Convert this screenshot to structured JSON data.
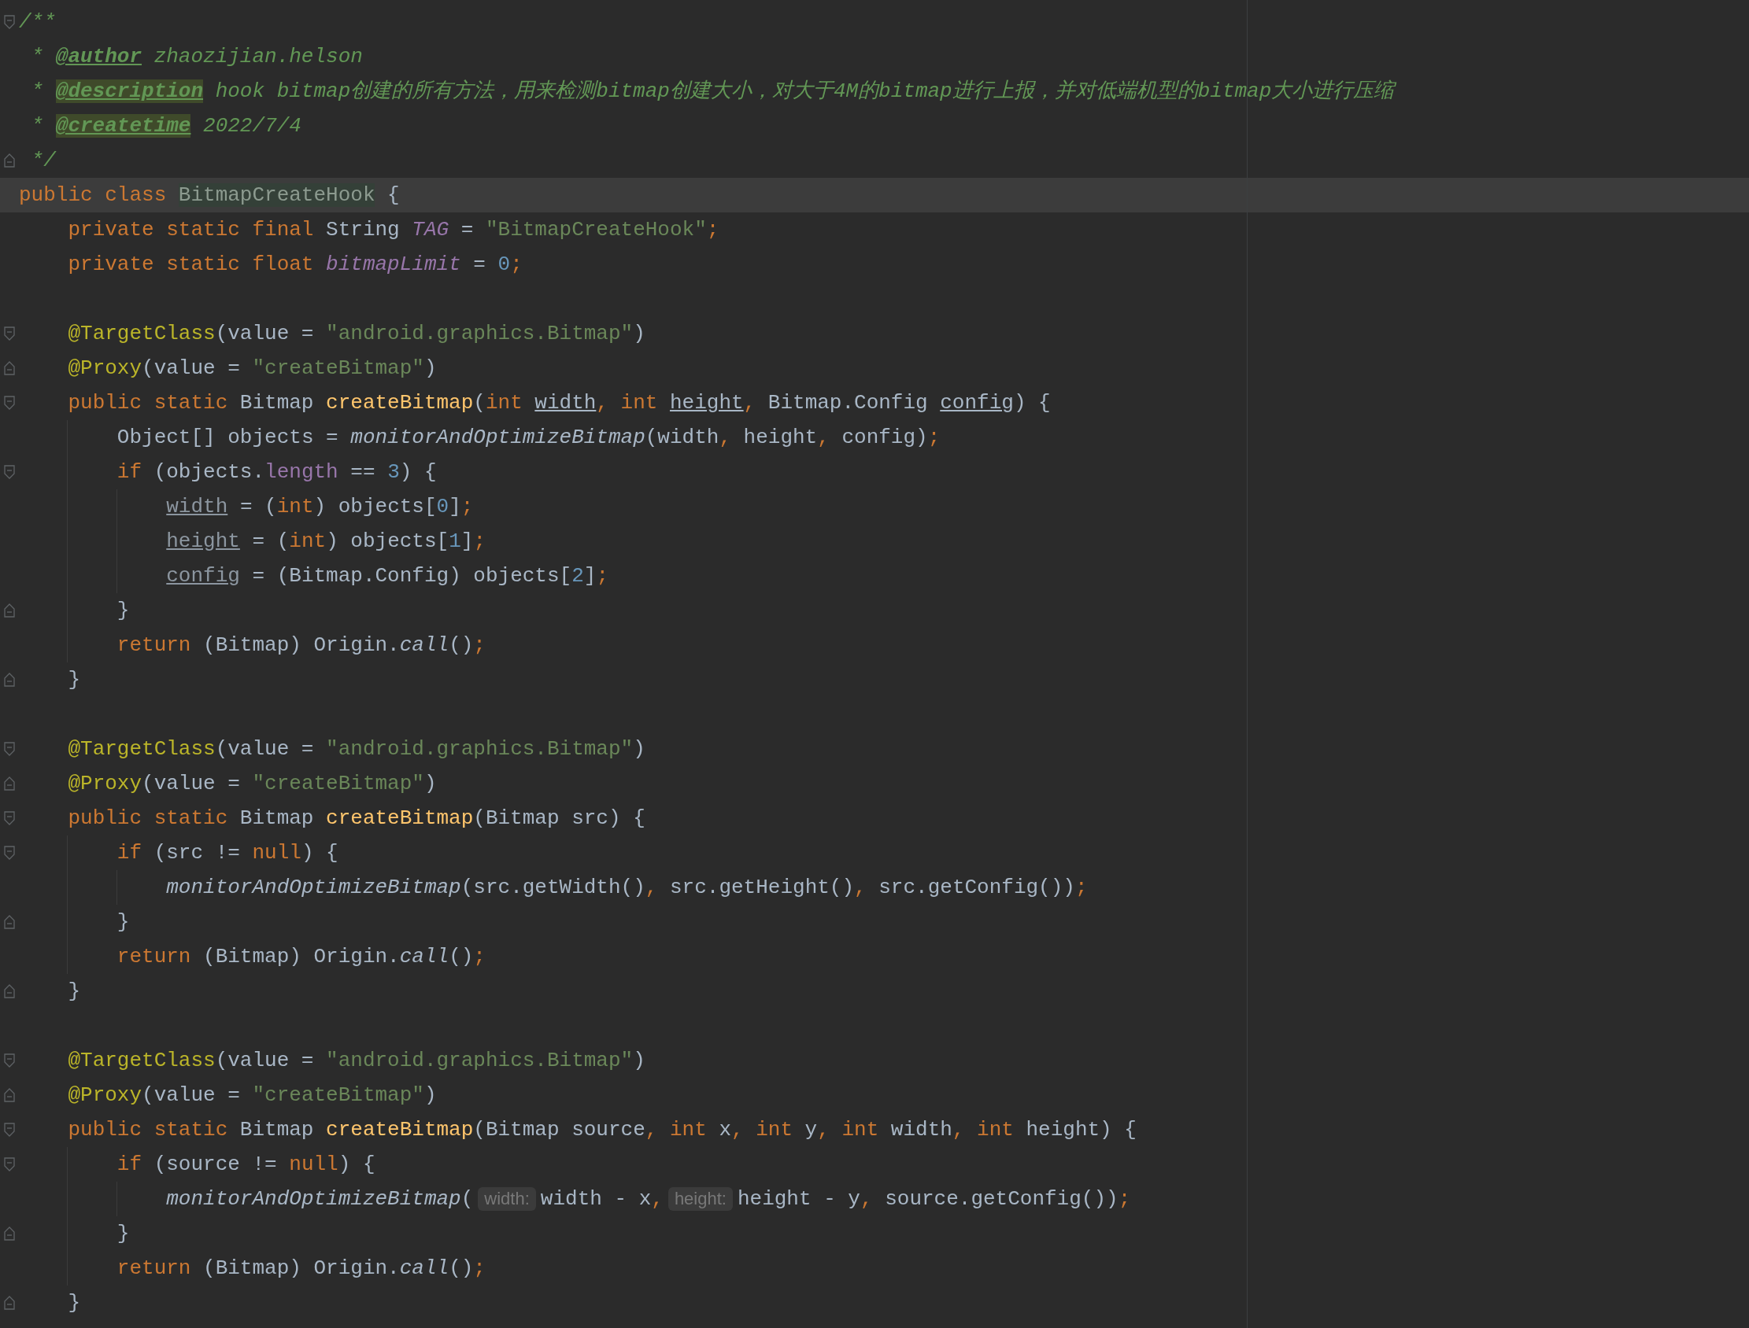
{
  "editor": {
    "lines": [
      {
        "current": false,
        "fold_start": true,
        "fold_end": false,
        "tokens": [
          {
            "kind": "doc",
            "text": "/**"
          }
        ]
      },
      {
        "current": false,
        "fold_start": false,
        "fold_end": false,
        "tokens": [
          {
            "kind": "doc",
            "text": " * "
          },
          {
            "kind": "doctag",
            "text": "@author"
          },
          {
            "kind": "doc",
            "text": " zhaozijian.helson"
          }
        ]
      },
      {
        "current": false,
        "fold_start": false,
        "fold_end": false,
        "tokens": [
          {
            "kind": "doc",
            "text": " * "
          },
          {
            "kind": "doctag_hl",
            "text": "@description"
          },
          {
            "kind": "doc",
            "text": " hook bitmap创建的所有方法，用来检测bitmap创建大小，对大于4M的bitmap进行上报，并对低端机型的bitmap大小进行压缩"
          }
        ]
      },
      {
        "current": false,
        "fold_start": false,
        "fold_end": false,
        "tokens": [
          {
            "kind": "doc",
            "text": " * "
          },
          {
            "kind": "doctag_hl",
            "text": "@createtime"
          },
          {
            "kind": "doc",
            "text": " 2022/7/4"
          }
        ]
      },
      {
        "current": false,
        "fold_start": false,
        "fold_end": true,
        "tokens": [
          {
            "kind": "doc",
            "text": " */"
          }
        ]
      },
      {
        "current": true,
        "fold_start": false,
        "fold_end": false,
        "tokens": [
          {
            "kind": "kw",
            "text": "public class "
          },
          {
            "kind": "classhl",
            "text": "BitmapCreateHook"
          },
          {
            "kind": "p",
            "text": " {"
          }
        ],
        "children": [
          {
            "current": false,
            "fold_start": false,
            "fold_end": false,
            "tokens": [
              {
                "kind": "kw",
                "text": "private static final "
              },
              {
                "kind": "p",
                "text": "String "
              },
              {
                "kind": "field",
                "text": "TAG"
              },
              {
                "kind": "p",
                "text": " = "
              },
              {
                "kind": "str",
                "text": "\"BitmapCreateHook\""
              },
              {
                "kind": "kw",
                "text": ";"
              }
            ]
          },
          {
            "current": false,
            "fold_start": false,
            "fold_end": false,
            "tokens": [
              {
                "kind": "kw",
                "text": "private static float "
              },
              {
                "kind": "field",
                "text": "bitmapLimit"
              },
              {
                "kind": "p",
                "text": " = "
              },
              {
                "kind": "num",
                "text": "0"
              },
              {
                "kind": "kw",
                "text": ";"
              }
            ]
          },
          {
            "current": false,
            "fold_start": false,
            "fold_end": false
          },
          {
            "current": false,
            "fold_start": true,
            "fold_end": false,
            "tokens": [
              {
                "kind": "ann",
                "text": "@TargetClass"
              },
              {
                "kind": "p",
                "text": "(value = "
              },
              {
                "kind": "str",
                "text": "\"android.graphics.Bitmap\""
              },
              {
                "kind": "p",
                "text": ")"
              }
            ]
          },
          {
            "current": false,
            "fold_start": false,
            "fold_end": true,
            "tokens": [
              {
                "kind": "ann",
                "text": "@Proxy"
              },
              {
                "kind": "p",
                "text": "(value = "
              },
              {
                "kind": "str",
                "text": "\"createBitmap\""
              },
              {
                "kind": "p",
                "text": ")"
              }
            ]
          },
          {
            "current": false,
            "fold_start": true,
            "fold_end": false,
            "tokens": [
              {
                "kind": "kw",
                "text": "public static "
              },
              {
                "kind": "p",
                "text": "Bitmap "
              },
              {
                "kind": "fndecl",
                "text": "createBitmap"
              },
              {
                "kind": "p",
                "text": "("
              },
              {
                "kind": "kw",
                "text": "int "
              },
              {
                "kind": "ul",
                "text": "width"
              },
              {
                "kind": "kw",
                "text": ", int "
              },
              {
                "kind": "ul",
                "text": "height"
              },
              {
                "kind": "kw",
                "text": ", "
              },
              {
                "kind": "p",
                "text": "Bitmap.Config "
              },
              {
                "kind": "ul",
                "text": "config"
              },
              {
                "kind": "p",
                "text": ") {"
              }
            ],
            "children": [
              {
                "current": false,
                "fold_start": false,
                "fold_end": false,
                "tokens": [
                  {
                    "kind": "p",
                    "text": "Object[] objects = "
                  },
                  {
                    "kind": "ital",
                    "text": "monitorAndOptimizeBitmap"
                  },
                  {
                    "kind": "p",
                    "text": "(width"
                  },
                  {
                    "kind": "kw",
                    "text": ", "
                  },
                  {
                    "kind": "p",
                    "text": "height"
                  },
                  {
                    "kind": "kw",
                    "text": ", "
                  },
                  {
                    "kind": "p",
                    "text": "config)"
                  },
                  {
                    "kind": "kw",
                    "text": ";"
                  }
                ]
              },
              {
                "current": false,
                "fold_start": true,
                "fold_end": false,
                "tokens": [
                  {
                    "kind": "kw",
                    "text": "if "
                  },
                  {
                    "kind": "p",
                    "text": "(objects."
                  },
                  {
                    "kind": "prop",
                    "text": "length"
                  },
                  {
                    "kind": "p",
                    "text": " == "
                  },
                  {
                    "kind": "num",
                    "text": "3"
                  },
                  {
                    "kind": "p",
                    "text": ") {"
                  }
                ],
                "children": [
                  {
                    "current": false,
                    "fold_start": false,
                    "fold_end": false,
                    "tokens": [
                      {
                        "kind": "reassigned",
                        "text": "width"
                      },
                      {
                        "kind": "p",
                        "text": " = ("
                      },
                      {
                        "kind": "kw",
                        "text": "int"
                      },
                      {
                        "kind": "p",
                        "text": ") objects["
                      },
                      {
                        "kind": "num",
                        "text": "0"
                      },
                      {
                        "kind": "p",
                        "text": "]"
                      },
                      {
                        "kind": "kw",
                        "text": ";"
                      }
                    ]
                  },
                  {
                    "current": false,
                    "fold_start": false,
                    "fold_end": false,
                    "tokens": [
                      {
                        "kind": "reassigned",
                        "text": "height"
                      },
                      {
                        "kind": "p",
                        "text": " = ("
                      },
                      {
                        "kind": "kw",
                        "text": "int"
                      },
                      {
                        "kind": "p",
                        "text": ") objects["
                      },
                      {
                        "kind": "num",
                        "text": "1"
                      },
                      {
                        "kind": "p",
                        "text": "]"
                      },
                      {
                        "kind": "kw",
                        "text": ";"
                      }
                    ]
                  },
                  {
                    "current": false,
                    "fold_start": false,
                    "fold_end": false,
                    "tokens": [
                      {
                        "kind": "reassigned",
                        "text": "config"
                      },
                      {
                        "kind": "p",
                        "text": " = (Bitmap.Config) objects["
                      },
                      {
                        "kind": "num",
                        "text": "2"
                      },
                      {
                        "kind": "p",
                        "text": "]"
                      },
                      {
                        "kind": "kw",
                        "text": ";"
                      }
                    ]
                  }
                ]
              },
              {
                "current": false,
                "fold_start": false,
                "fold_end": true,
                "tokens": [
                  {
                    "kind": "p",
                    "text": "}"
                  }
                ]
              },
              {
                "current": false,
                "fold_start": false,
                "fold_end": false,
                "tokens": [
                  {
                    "kind": "kw",
                    "text": "return "
                  },
                  {
                    "kind": "p",
                    "text": "(Bitmap) Origin."
                  },
                  {
                    "kind": "ital",
                    "text": "call"
                  },
                  {
                    "kind": "p",
                    "text": "()"
                  },
                  {
                    "kind": "kw",
                    "text": ";"
                  }
                ]
              }
            ]
          },
          {
            "current": false,
            "fold_start": false,
            "fold_end": true,
            "tokens": [
              {
                "kind": "p",
                "text": "}"
              }
            ]
          },
          {
            "current": false,
            "fold_start": false,
            "fold_end": false
          },
          {
            "current": false,
            "fold_start": true,
            "fold_end": false,
            "tokens": [
              {
                "kind": "ann",
                "text": "@TargetClass"
              },
              {
                "kind": "p",
                "text": "(value = "
              },
              {
                "kind": "str",
                "text": "\"android.graphics.Bitmap\""
              },
              {
                "kind": "p",
                "text": ")"
              }
            ]
          },
          {
            "current": false,
            "fold_start": false,
            "fold_end": true,
            "tokens": [
              {
                "kind": "ann",
                "text": "@Proxy"
              },
              {
                "kind": "p",
                "text": "(value = "
              },
              {
                "kind": "str",
                "text": "\"createBitmap\""
              },
              {
                "kind": "p",
                "text": ")"
              }
            ]
          },
          {
            "current": false,
            "fold_start": true,
            "fold_end": false,
            "tokens": [
              {
                "kind": "kw",
                "text": "public static "
              },
              {
                "kind": "p",
                "text": "Bitmap "
              },
              {
                "kind": "fndecl",
                "text": "createBitmap"
              },
              {
                "kind": "p",
                "text": "(Bitmap src) {"
              }
            ],
            "children": [
              {
                "current": false,
                "fold_start": true,
                "fold_end": false,
                "tokens": [
                  {
                    "kind": "kw",
                    "text": "if "
                  },
                  {
                    "kind": "p",
                    "text": "(src != "
                  },
                  {
                    "kind": "kw",
                    "text": "null"
                  },
                  {
                    "kind": "p",
                    "text": ") {"
                  }
                ],
                "children": [
                  {
                    "current": false,
                    "fold_start": false,
                    "fold_end": false,
                    "tokens": [
                      {
                        "kind": "ital",
                        "text": "monitorAndOptimizeBitmap"
                      },
                      {
                        "kind": "p",
                        "text": "(src.getWidth()"
                      },
                      {
                        "kind": "kw",
                        "text": ", "
                      },
                      {
                        "kind": "p",
                        "text": "src.getHeight()"
                      },
                      {
                        "kind": "kw",
                        "text": ", "
                      },
                      {
                        "kind": "p",
                        "text": "src.getConfig())"
                      },
                      {
                        "kind": "kw",
                        "text": ";"
                      }
                    ]
                  }
                ]
              },
              {
                "current": false,
                "fold_start": false,
                "fold_end": true,
                "tokens": [
                  {
                    "kind": "p",
                    "text": "}"
                  }
                ]
              },
              {
                "current": false,
                "fold_start": false,
                "fold_end": false,
                "tokens": [
                  {
                    "kind": "kw",
                    "text": "return "
                  },
                  {
                    "kind": "p",
                    "text": "(Bitmap) Origin."
                  },
                  {
                    "kind": "ital",
                    "text": "call"
                  },
                  {
                    "kind": "p",
                    "text": "()"
                  },
                  {
                    "kind": "kw",
                    "text": ";"
                  }
                ]
              }
            ]
          },
          {
            "current": false,
            "fold_start": false,
            "fold_end": true,
            "tokens": [
              {
                "kind": "p",
                "text": "}"
              }
            ]
          },
          {
            "current": false,
            "fold_start": false,
            "fold_end": false
          },
          {
            "current": false,
            "fold_start": true,
            "fold_end": false,
            "tokens": [
              {
                "kind": "ann",
                "text": "@TargetClass"
              },
              {
                "kind": "p",
                "text": "(value = "
              },
              {
                "kind": "str",
                "text": "\"android.graphics.Bitmap\""
              },
              {
                "kind": "p",
                "text": ")"
              }
            ]
          },
          {
            "current": false,
            "fold_start": false,
            "fold_end": true,
            "tokens": [
              {
                "kind": "ann",
                "text": "@Proxy"
              },
              {
                "kind": "p",
                "text": "(value = "
              },
              {
                "kind": "str",
                "text": "\"createBitmap\""
              },
              {
                "kind": "p",
                "text": ")"
              }
            ]
          },
          {
            "current": false,
            "fold_start": true,
            "fold_end": false,
            "tokens": [
              {
                "kind": "kw",
                "text": "public static "
              },
              {
                "kind": "p",
                "text": "Bitmap "
              },
              {
                "kind": "fndecl",
                "text": "createBitmap"
              },
              {
                "kind": "p",
                "text": "(Bitmap source"
              },
              {
                "kind": "kw",
                "text": ", int "
              },
              {
                "kind": "p",
                "text": "x"
              },
              {
                "kind": "kw",
                "text": ", int "
              },
              {
                "kind": "p",
                "text": "y"
              },
              {
                "kind": "kw",
                "text": ", int "
              },
              {
                "kind": "p",
                "text": "width"
              },
              {
                "kind": "kw",
                "text": ", int "
              },
              {
                "kind": "p",
                "text": "height) {"
              }
            ],
            "children": [
              {
                "current": false,
                "fold_start": true,
                "fold_end": false,
                "tokens": [
                  {
                    "kind": "kw",
                    "text": "if "
                  },
                  {
                    "kind": "p",
                    "text": "(source != "
                  },
                  {
                    "kind": "kw",
                    "text": "null"
                  },
                  {
                    "kind": "p",
                    "text": ") {"
                  }
                ],
                "children": [
                  {
                    "current": false,
                    "fold_start": false,
                    "fold_end": false,
                    "tokens": [
                      {
                        "kind": "ital",
                        "text": "monitorAndOptimizeBitmap"
                      },
                      {
                        "kind": "p",
                        "text": "("
                      },
                      {
                        "kind": "hint",
                        "text": "width:"
                      },
                      {
                        "kind": "p",
                        "text": "width - x"
                      },
                      {
                        "kind": "kw",
                        "text": ","
                      },
                      {
                        "kind": "hint",
                        "text": "height:"
                      },
                      {
                        "kind": "p",
                        "text": "height - y"
                      },
                      {
                        "kind": "kw",
                        "text": ", "
                      },
                      {
                        "kind": "p",
                        "text": "source.getConfig())"
                      },
                      {
                        "kind": "kw",
                        "text": ";"
                      }
                    ]
                  }
                ]
              },
              {
                "current": false,
                "fold_start": false,
                "fold_end": true,
                "tokens": [
                  {
                    "kind": "p",
                    "text": "}"
                  }
                ]
              },
              {
                "current": false,
                "fold_start": false,
                "fold_end": false,
                "tokens": [
                  {
                    "kind": "kw",
                    "text": "return "
                  },
                  {
                    "kind": "p",
                    "text": "(Bitmap) Origin."
                  },
                  {
                    "kind": "ital",
                    "text": "call"
                  },
                  {
                    "kind": "p",
                    "text": "()"
                  },
                  {
                    "kind": "kw",
                    "text": ";"
                  }
                ]
              }
            ]
          },
          {
            "current": false,
            "fold_start": false,
            "fold_end": true,
            "tokens": [
              {
                "kind": "p",
                "text": "}"
              }
            ]
          }
        ]
      }
    ]
  }
}
